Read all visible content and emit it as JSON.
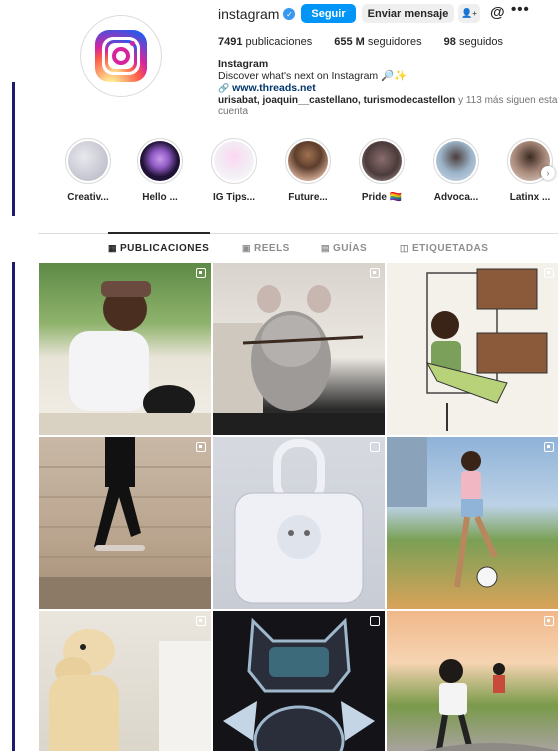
{
  "profile": {
    "username": "instagram",
    "follow_label": "Seguir",
    "message_label": "Enviar mensaje",
    "add_user_glyph": "+",
    "threads_glyph": "@",
    "more_glyph": "•••"
  },
  "stats": {
    "posts_count": "7491",
    "posts_label": "publicaciones",
    "followers_count": "655 M",
    "followers_label": "seguidores",
    "following_count": "98",
    "following_label": "seguidos"
  },
  "bio": {
    "name": "Instagram",
    "text": "Discover what's next on Instagram 🔎✨",
    "link": "www.threads.net"
  },
  "followed_by": {
    "users": "urisabat, joaquin__castellano, turismodecastellon",
    "rest": " y 113 más siguen esta cuenta"
  },
  "highlights": [
    {
      "label": "Creativ...",
      "color": "#c9c9d4"
    },
    {
      "label": "Hello ...",
      "color": "#2b1a4a"
    },
    {
      "label": "IG Tips...",
      "color": "#f4e8f4"
    },
    {
      "label": "Future...",
      "color": "#6b4a3a"
    },
    {
      "label": "Pride 🏳️‍🌈",
      "color": "#7a6a6a"
    },
    {
      "label": "Advoca...",
      "color": "#8aa0b8"
    },
    {
      "label": "Latinx ...",
      "color": "#a58878"
    }
  ],
  "tabs": [
    {
      "label": "PUBLICACIONES",
      "icon": "grid-icon"
    },
    {
      "label": "REELS",
      "icon": "reels-icon"
    },
    {
      "label": "GUÍAS",
      "icon": "guides-icon"
    },
    {
      "label": "ETIQUETADAS",
      "icon": "tagged-icon"
    }
  ],
  "colors": {
    "accent": "#0095f6",
    "side_line": "#1e1a6e"
  }
}
